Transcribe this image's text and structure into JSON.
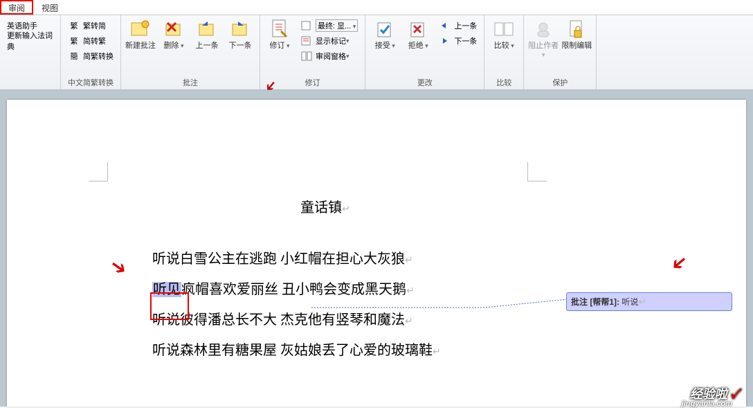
{
  "tabs": {
    "review": "审阅",
    "view": "视图"
  },
  "ribbon": {
    "group_left": {
      "item1": "英语助手",
      "item2": "更新输入法词典"
    },
    "group_convert": {
      "btn1": "繁转简",
      "btn2": "简转繁",
      "btn3": "简繁转换",
      "label": "中文简繁转换"
    },
    "group_comments": {
      "new": "新建批注",
      "delete": "删除",
      "prev": "上一条",
      "next": "下一条",
      "label": "批注"
    },
    "group_track": {
      "track": "修订",
      "display": "显示标记",
      "pane": "审阅窗格",
      "final_dd": "最终: 显...",
      "label": "修订"
    },
    "group_changes": {
      "accept": "接受",
      "reject": "拒绝",
      "prev": "上一条",
      "next": "下一条",
      "label": "更改"
    },
    "group_compare": {
      "compare": "比较",
      "label": "比较"
    },
    "group_protect": {
      "block": "阻止作者",
      "restrict": "限制编辑",
      "label": "保护"
    }
  },
  "document": {
    "title": "童话镇",
    "line1": "听说白雪公主在逃跑  小红帽在担心大灰狼",
    "line2_sel": "听见",
    "line2_rest": "疯帽喜欢爱丽丝  丑小鸭会变成黑天鹅",
    "line3": "听说彼得潘总长不大  杰克他有竖琴和魔法",
    "line4": "听说森林里有糖果屋  灰姑娘丢了心爱的玻璃鞋"
  },
  "comment": {
    "prefix": "批注 ",
    "author": "[帮帮1]:",
    "text": "听说"
  },
  "watermark": {
    "main": "经验啦",
    "check": "✓",
    "sub": "jingyanla.com"
  }
}
